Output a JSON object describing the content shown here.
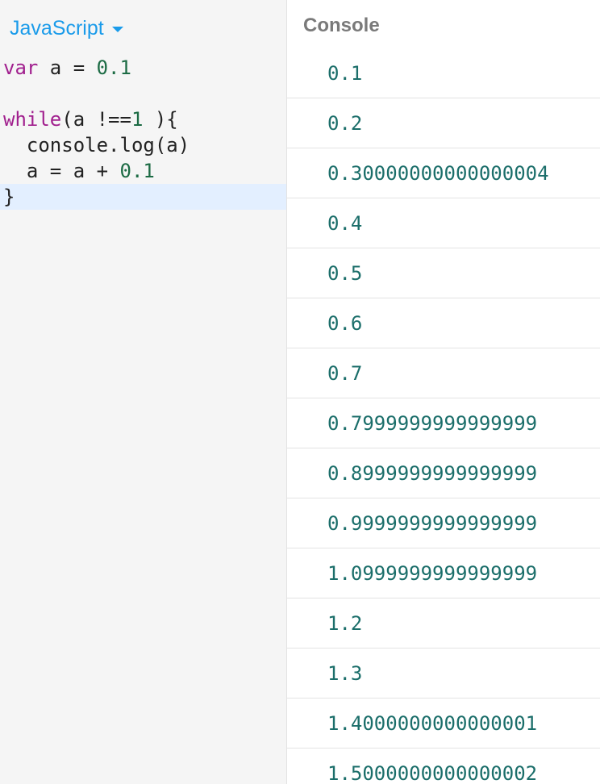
{
  "editor": {
    "language": "JavaScript",
    "lines": [
      [
        {
          "t": "var",
          "c": "kw"
        },
        {
          "t": " a = "
        },
        {
          "t": "0.1",
          "c": "num"
        }
      ],
      [],
      [
        {
          "t": "while",
          "c": "kw"
        },
        {
          "t": "(a !=="
        },
        {
          "t": "1",
          "c": "num"
        },
        {
          "t": " ){"
        }
      ],
      [
        {
          "t": "  console.log(a)"
        }
      ],
      [
        {
          "t": "  a = a + "
        },
        {
          "t": "0.1",
          "c": "num"
        }
      ],
      [
        {
          "t": "}"
        }
      ]
    ],
    "active_line": 5
  },
  "console": {
    "title": "Console",
    "outputs": [
      "0.1",
      "0.2",
      "0.30000000000000004",
      "0.4",
      "0.5",
      "0.6",
      "0.7",
      "0.7999999999999999",
      "0.8999999999999999",
      "0.9999999999999999",
      "1.0999999999999999",
      "1.2",
      "1.3",
      "1.4000000000000001",
      "1.5000000000000002"
    ]
  },
  "colors": {
    "accent": "#1a9bea",
    "keyword": "#a1208e",
    "number": "#1c6b44",
    "console_text": "#1b6e6a",
    "active_line": "#e3efff"
  },
  "icons": {
    "language_dropdown": "chevron-down-icon"
  }
}
